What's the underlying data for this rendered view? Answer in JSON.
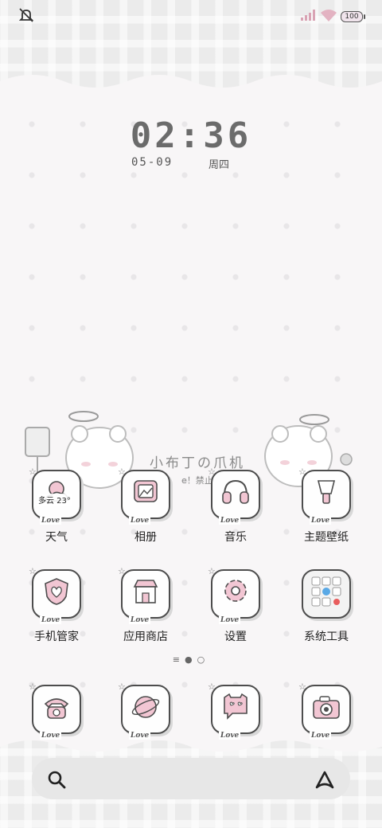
{
  "status_bar": {
    "battery": "100",
    "icons": [
      "mute-icon",
      "signal-icon",
      "wifi-icon",
      "battery-icon"
    ]
  },
  "clock": {
    "time": "02:36",
    "date": "05-09",
    "weekday": "周四"
  },
  "widget_text": "小布丁の爪机",
  "widget_subtext": "e！禁止",
  "weather": {
    "text": "多云 23°"
  },
  "apps_row1": [
    {
      "label": "天气",
      "icon": "weather-icon"
    },
    {
      "label": "相册",
      "icon": "album-icon"
    },
    {
      "label": "音乐",
      "icon": "headphones-icon"
    },
    {
      "label": "主题壁纸",
      "icon": "theme-icon"
    }
  ],
  "apps_row2": [
    {
      "label": "手机管家",
      "icon": "shield-icon"
    },
    {
      "label": "应用商店",
      "icon": "store-icon"
    },
    {
      "label": "设置",
      "icon": "gear-icon"
    },
    {
      "label": "系统工具",
      "icon": "folder-icon"
    }
  ],
  "dock": [
    {
      "icon": "phone-icon"
    },
    {
      "icon": "browser-icon"
    },
    {
      "icon": "message-icon"
    },
    {
      "icon": "camera-icon"
    }
  ],
  "icon_tag": "Love",
  "search": {
    "icons": [
      "search-icon",
      "assistant-icon"
    ]
  },
  "colors": {
    "accent_pink": "#f2c6d3",
    "outline": "#4d4d4d",
    "background": "#f8f6f7"
  }
}
